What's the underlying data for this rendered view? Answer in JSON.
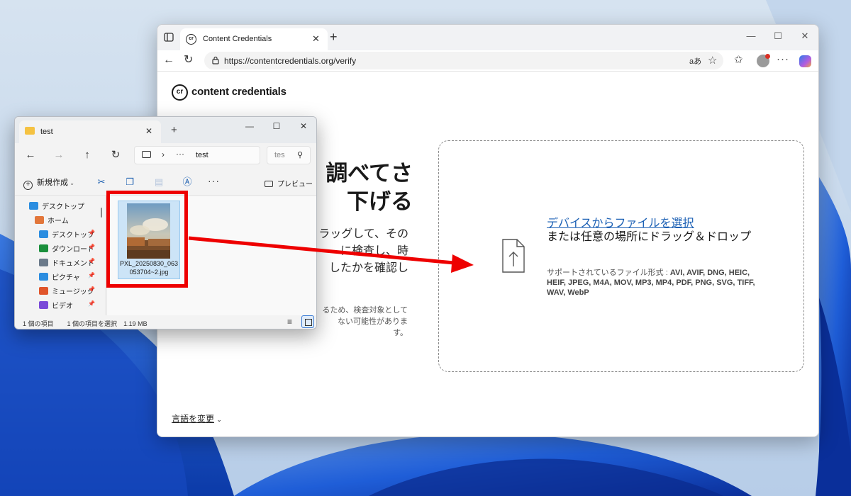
{
  "browser": {
    "tab_title": "Content Credentials",
    "tab_favicon": "cr",
    "url": "https://contentcredentials.org/verify",
    "read_aloud_label": "aあ",
    "icons": [
      "sidebar-toggle-icon",
      "back-arrow-icon",
      "refresh-icon",
      "lock-icon",
      "favorites-star-icon",
      "collections-icon",
      "profile-avatar-icon",
      "more-icon",
      "copilot-icon",
      "minimize-icon",
      "maximize-icon",
      "close-icon"
    ]
  },
  "page": {
    "logo_mark": "cr",
    "logo_text": "content credentials",
    "hero_title_line1": "調べてさ",
    "hero_title_line2": "下げる",
    "hero_body_line1": "ラッグして、その",
    "hero_body_line2": "に検査し、時",
    "hero_body_line3": "したかを確認し",
    "hero_note_line1": "るため、検査対象として",
    "hero_note_line2": "ない可能性がありま",
    "hero_note_line3": "す。",
    "dropzone": {
      "link_text": "デバイスからファイルを選択",
      "drag_text": "または任意の場所にドラッグ＆ドロップ",
      "formats_label": "サポートされているファイル形式 :",
      "formats_list": "AVI, AVIF, DNG, HEIC, HEIF, JPEG, M4A, MOV, MP3, MP4, PDF, PNG, SVG, TIFF, WAV, WebP"
    },
    "language_switch": "言語を変更"
  },
  "explorer": {
    "tab_title": "test",
    "path_ellipsis": "···",
    "path_folder": "test",
    "search_placeholder": "tes",
    "new_button": "新規作成",
    "preview_button": "プレビュー",
    "more_label": "···",
    "sidebar": [
      {
        "label": "デスクトップ",
        "icon": "desktop-icon",
        "pinned": false,
        "color": "#2b8de0"
      },
      {
        "label": "ホーム",
        "icon": "home-icon",
        "pinned": false,
        "color": "#e2763a"
      },
      {
        "label": "デスクトップ",
        "icon": "desktop-icon",
        "pinned": true,
        "color": "#2b8de0"
      },
      {
        "label": "ダウンロード",
        "icon": "download-icon",
        "pinned": true,
        "color": "#1a8f3c"
      },
      {
        "label": "ドキュメント",
        "icon": "document-icon",
        "pinned": true,
        "color": "#6b7a8a"
      },
      {
        "label": "ピクチャ",
        "icon": "pictures-icon",
        "pinned": true,
        "color": "#2b8de0"
      },
      {
        "label": "ミュージック",
        "icon": "music-icon",
        "pinned": true,
        "color": "#e0552b"
      },
      {
        "label": "ビデオ",
        "icon": "video-icon",
        "pinned": true,
        "color": "#7a4ad8"
      }
    ],
    "file": {
      "name": "PXL_20250830_063053704~2.jpg"
    },
    "status": {
      "item_count": "1 個の項目",
      "selection": "1 個の項目を選択",
      "size": "1.19 MB"
    }
  },
  "colors": {
    "link": "#1a5fb4",
    "annotation_red": "#ee0000",
    "selection_blue": "#cce4f7"
  }
}
